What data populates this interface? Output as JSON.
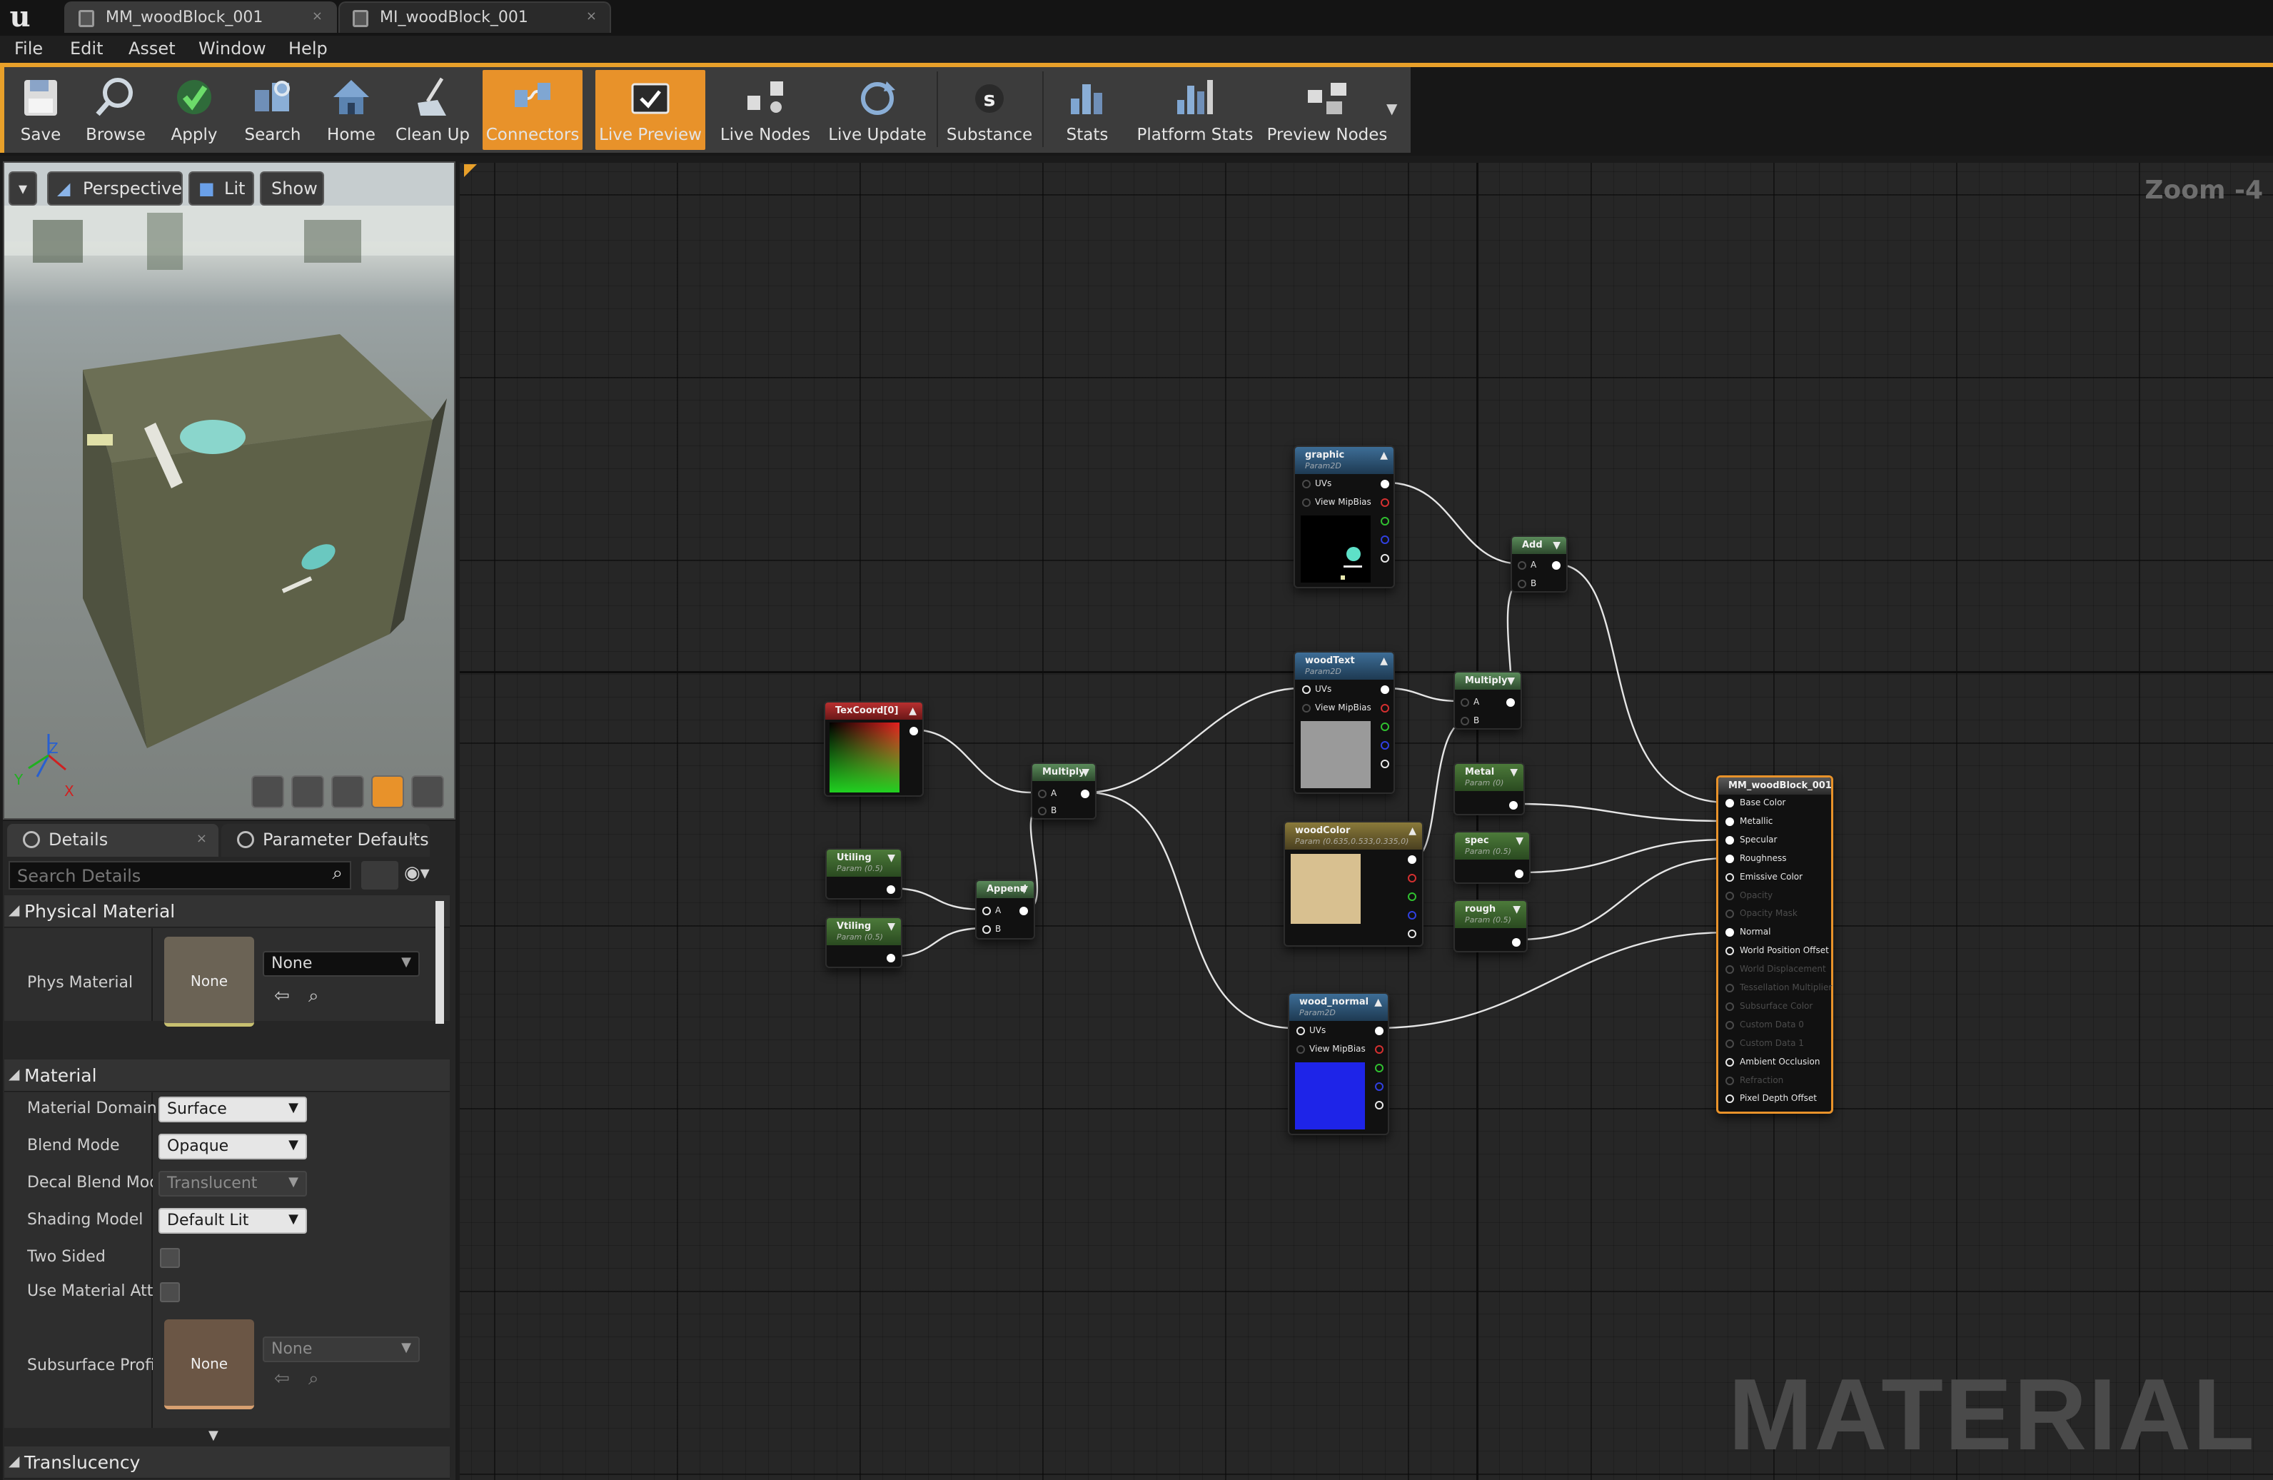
{
  "tabs": [
    {
      "label": "MM_woodBlock_001",
      "close": "×"
    },
    {
      "label": "MI_woodBlock_001",
      "close": "×"
    }
  ],
  "menu": [
    "File",
    "Edit",
    "Asset",
    "Window",
    "Help"
  ],
  "toolbar": {
    "buttons": [
      {
        "label": "Save",
        "icon": "save-icon"
      },
      {
        "label": "Browse",
        "icon": "browse-icon"
      },
      {
        "label": "Apply",
        "icon": "apply-icon"
      },
      {
        "label": "Search",
        "icon": "search-icon"
      },
      {
        "label": "Home",
        "icon": "home-icon"
      },
      {
        "label": "Clean Up",
        "icon": "clean-up-icon"
      },
      {
        "label": "Connectors",
        "icon": "connectors-icon",
        "active": true
      },
      {
        "label": "Live Preview",
        "icon": "live-preview-icon",
        "active": true
      },
      {
        "label": "Live Nodes",
        "icon": "live-nodes-icon"
      },
      {
        "label": "Live Update",
        "icon": "live-update-icon"
      },
      {
        "label": "Substance",
        "icon": "substance-icon"
      },
      {
        "label": "Stats",
        "icon": "stats-icon"
      },
      {
        "label": "Platform Stats",
        "icon": "platform-stats-icon"
      },
      {
        "label": "Preview Nodes",
        "icon": "preview-nodes-icon"
      }
    ],
    "accent": "#e8922a"
  },
  "viewport": {
    "perspective": "Perspective",
    "lit": "Lit",
    "show": "Show",
    "axes": {
      "z": "Z",
      "y": "Y",
      "x": "X"
    }
  },
  "details": {
    "tab_details": "Details",
    "tab_params": "Parameter Defaults",
    "search_placeholder": "Search Details",
    "physical_section": "Physical Material",
    "phys_material_label": "Phys Material",
    "phys_material_thumb": "None",
    "phys_material_value": "None",
    "material_section": "Material",
    "rows": [
      {
        "label": "Material Domain",
        "value": "Surface"
      },
      {
        "label": "Blend Mode",
        "value": "Opaque"
      },
      {
        "label": "Decal Blend Mode",
        "value": "Translucent"
      },
      {
        "label": "Shading Model",
        "value": "Default Lit"
      }
    ],
    "two_sided": "Two Sided",
    "use_material_attr": "Use Material Attri",
    "subsurface_label": "Subsurface Profil",
    "subsurface_thumb": "None",
    "subsurface_value": "None",
    "translucency_section": "Translucency"
  },
  "graph": {
    "zoom": "Zoom -4",
    "watermark": "MATERIAL",
    "nodes": {
      "graphic": {
        "title": "graphic",
        "sub": "Param2D",
        "pins": [
          "UVs",
          "View MipBias"
        ]
      },
      "woodtext": {
        "title": "woodText",
        "sub": "Param2D",
        "pins": [
          "UVs",
          "View MipBias"
        ]
      },
      "woodnormal": {
        "title": "wood_normal",
        "sub": "Param2D",
        "pins": [
          "UVs",
          "View MipBias"
        ]
      },
      "texcoord": {
        "title": "TexCoord[0]"
      },
      "multiply1": {
        "title": "Multiply",
        "pins": [
          "A",
          "B"
        ]
      },
      "multiply2": {
        "title": "Multiply",
        "pins": [
          "A",
          "B"
        ]
      },
      "append": {
        "title": "Append",
        "pins": [
          "A",
          "B"
        ]
      },
      "add": {
        "title": "Add",
        "pins": [
          "A",
          "B"
        ]
      },
      "utiling": {
        "title": "Utiling",
        "sub": "Param (0.5)"
      },
      "vtiling": {
        "title": "Vtiling",
        "sub": "Param (0.5)"
      },
      "woodcolor": {
        "title": "woodColor",
        "sub": "Param (0.635,0.533,0.335,0)"
      },
      "metal": {
        "title": "Metal",
        "sub": "Param (0)"
      },
      "spec": {
        "title": "spec",
        "sub": "Param (0.5)"
      },
      "rough": {
        "title": "rough",
        "sub": "Param (0.5)"
      },
      "result": {
        "title": "MM_woodBlock_001",
        "pins": [
          {
            "label": "Base Color",
            "on": true
          },
          {
            "label": "Metallic",
            "on": true
          },
          {
            "label": "Specular",
            "on": true
          },
          {
            "label": "Roughness",
            "on": true
          },
          {
            "label": "Emissive Color",
            "on": true
          },
          {
            "label": "Opacity",
            "on": false
          },
          {
            "label": "Opacity Mask",
            "on": false
          },
          {
            "label": "Normal",
            "on": true
          },
          {
            "label": "World Position Offset",
            "on": true
          },
          {
            "label": "World Displacement",
            "on": false
          },
          {
            "label": "Tessellation Multiplier",
            "on": false
          },
          {
            "label": "Subsurface Color",
            "on": false
          },
          {
            "label": "Custom Data 0",
            "on": false
          },
          {
            "label": "Custom Data 1",
            "on": false
          },
          {
            "label": "Ambient Occlusion",
            "on": true
          },
          {
            "label": "Refraction",
            "on": false
          },
          {
            "label": "Pixel Depth Offset",
            "on": true
          }
        ]
      }
    }
  }
}
